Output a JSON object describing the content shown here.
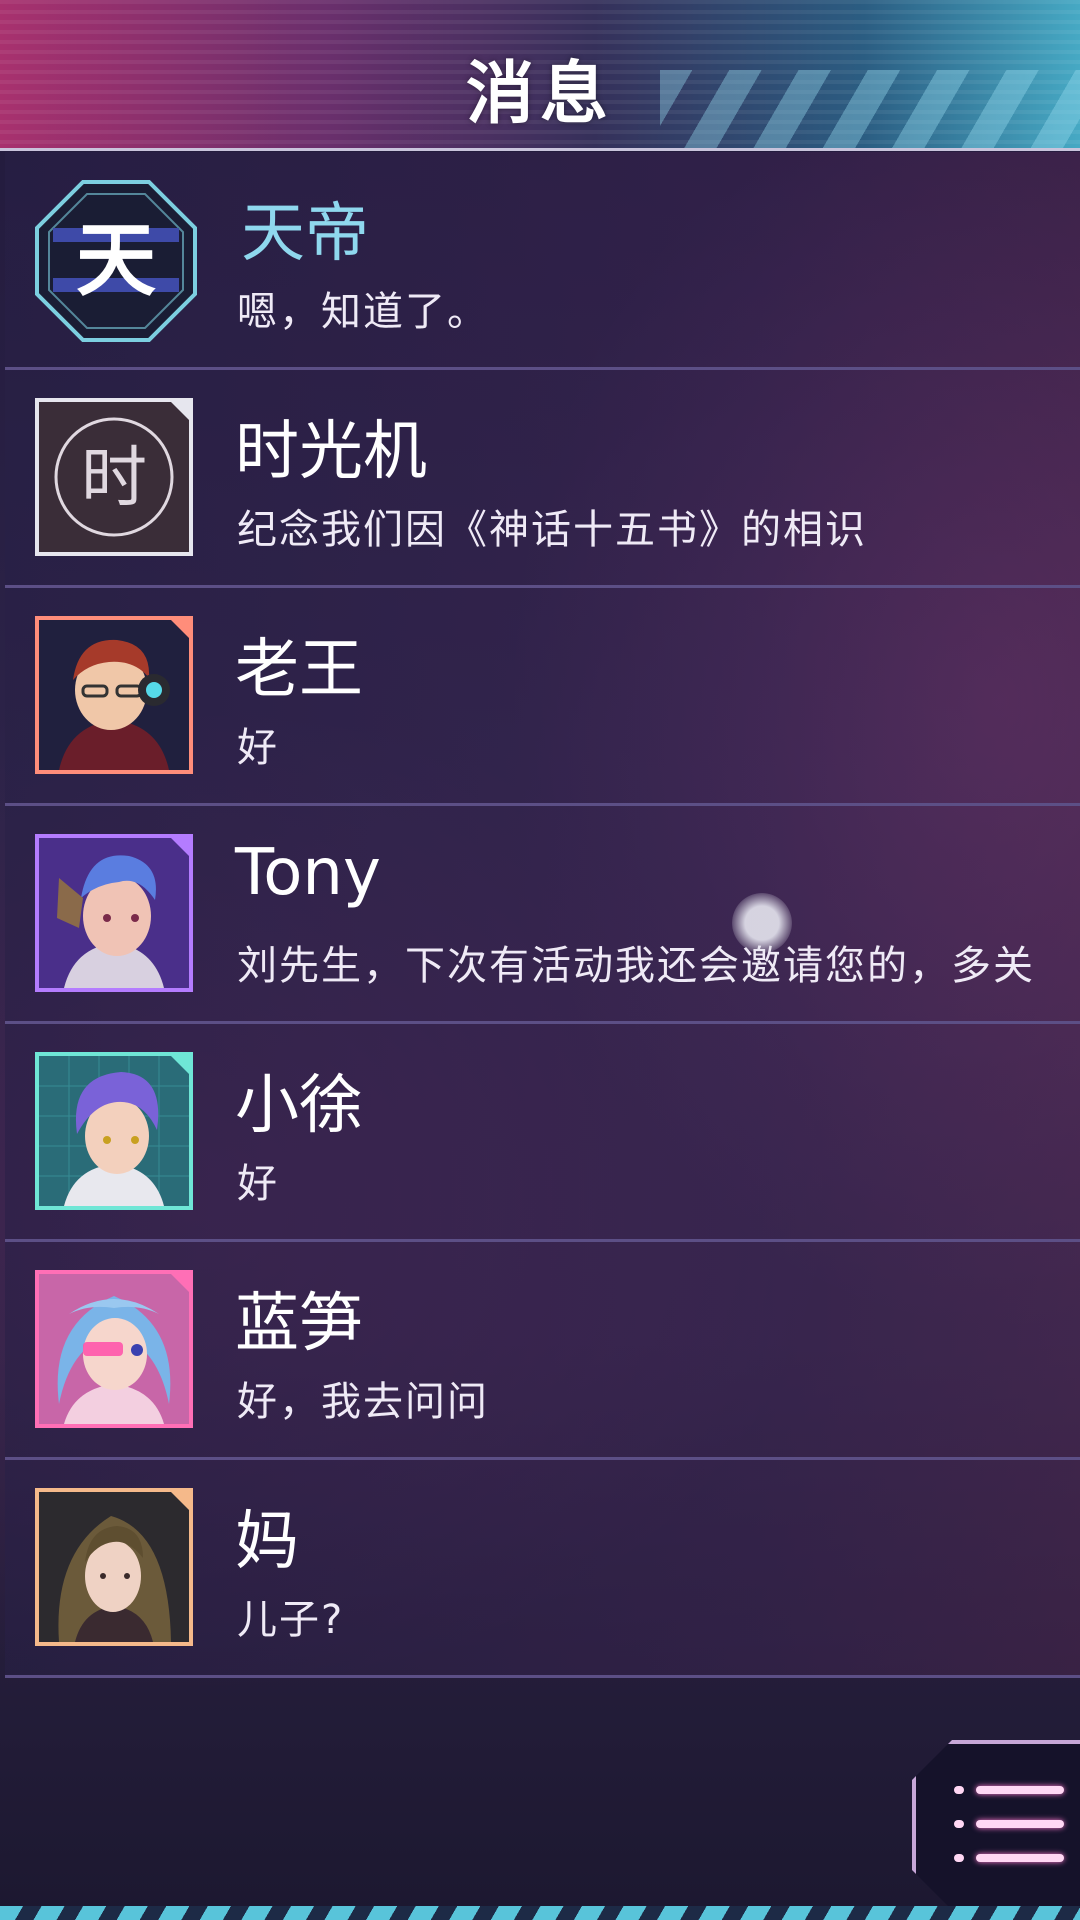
{
  "header": {
    "title": "消息"
  },
  "conversations": [
    {
      "name": "天帝",
      "message": "嗯，知道了。",
      "avatar": "tiandi-logo-icon",
      "frame_color": "#7ccfe0"
    },
    {
      "name": "时光机",
      "message": "纪念我们因《神话十五书》的相识",
      "avatar": "time-machine-logo-icon",
      "frame_color": "#e6e6ee"
    },
    {
      "name": "老王",
      "message": "好",
      "avatar": "laowang-avatar",
      "frame_color": "#ff8d7a"
    },
    {
      "name": "Tony",
      "message": "刘先生，下次有活动我还会邀请您的，多关",
      "avatar": "tony-avatar",
      "frame_color": "#b47cff"
    },
    {
      "name": "小徐",
      "message": "好",
      "avatar": "xiaoxu-avatar",
      "frame_color": "#6fe6d6"
    },
    {
      "name": "蓝笋",
      "message": "好，我去问问",
      "avatar": "lansun-avatar",
      "frame_color": "#ff6fb6"
    },
    {
      "name": "妈",
      "message": "儿子?",
      "avatar": "mom-avatar",
      "frame_color": "#f5b98a"
    }
  ],
  "tiandi_logo_text": "天",
  "timemachine_logo_text": "时",
  "menu": {
    "icon": "menu-list-icon"
  }
}
